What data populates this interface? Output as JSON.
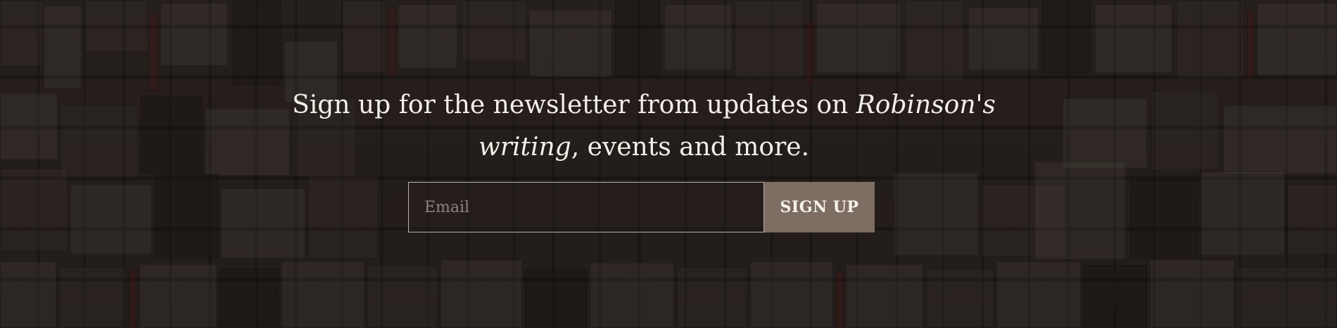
{
  "newsletter": {
    "headline_part1": "Sign up for the newsletter from updates on ",
    "headline_italic1": "Robinson's",
    "headline_italic2": "writing",
    "headline_part2": ", events and more.",
    "email_placeholder": "Email",
    "email_value": "",
    "signup_label": "SIGN UP"
  },
  "colors": {
    "background": "#2a2421",
    "headline_text": "#f4efe8",
    "input_border": "#b9b2ab",
    "placeholder": "#8c857f",
    "button_background": "#7d6d62",
    "button_text": "#f7f2ec"
  }
}
